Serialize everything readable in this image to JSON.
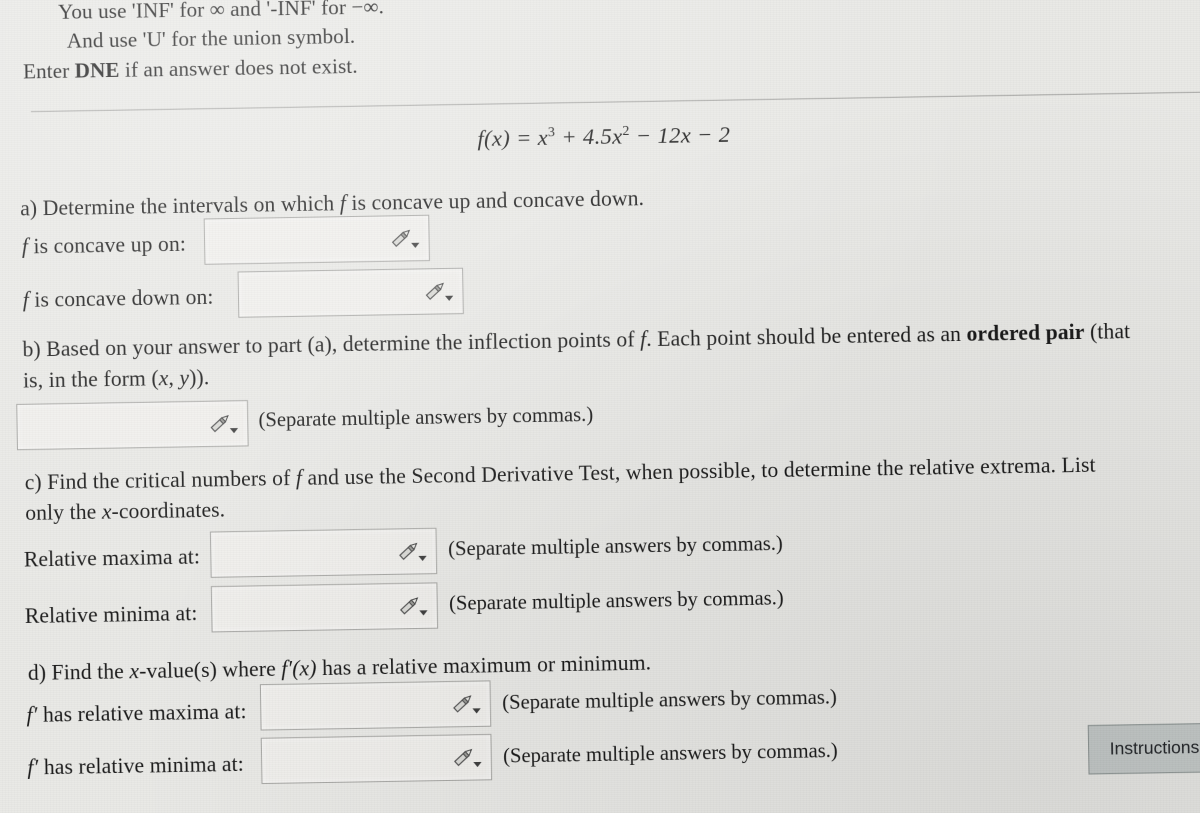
{
  "page": {
    "background_color": "#e9e9e6",
    "text_color": "#1b1b1b"
  },
  "header": {
    "line1": "You use 'INF' for ∞ and '-INF' for −∞.",
    "line2": "And use 'U' for the union symbol.",
    "line3_pre": "Enter ",
    "line3_bold": "DNE",
    "line3_post": " if an answer does not exist."
  },
  "equation": {
    "lhs": "f(x) = ",
    "term1": "x",
    "term1_exp": "3",
    "term2": " + 4.5x",
    "term2_exp": "2",
    "term3": " − 12x − 2",
    "plain": "f(x) = x^3 + 4.5x^2 − 12x − 2"
  },
  "parts": {
    "a": {
      "prompt": "a) Determine the intervals on which f is concave up and concave down.",
      "prompt_segments": [
        "a) Determine the intervals on which ",
        "f",
        " is concave up and concave down."
      ],
      "fields": [
        {
          "label_pre": "f",
          "label_post": " is concave up on:",
          "value": "",
          "icon": "pencil-icon"
        },
        {
          "label_pre": "f",
          "label_post": " is concave down on:",
          "value": "",
          "icon": "pencil-icon"
        }
      ]
    },
    "b": {
      "prompt_1a": "b) Based on your answer to part (a), determine the inflection points of ",
      "prompt_1b": "f",
      "prompt_1c": ". Each point should be entered as an ",
      "prompt_1_bold": "ordered pair",
      "prompt_1d": " (that",
      "prompt_2a": "is, in the form (",
      "prompt_2b": "x",
      "prompt_2c": ", ",
      "prompt_2d": "y",
      "prompt_2e": ")).",
      "field": {
        "value": "",
        "icon": "pencil-icon"
      },
      "hint": "(Separate multiple answers by commas.)"
    },
    "c": {
      "prompt_1a": "c) Find the critical numbers of ",
      "prompt_1b": "f",
      "prompt_1c": " and use the Second Derivative Test, when possible, to determine the relative extrema. List",
      "prompt_2a": "only the ",
      "prompt_2b": "x",
      "prompt_2c": "-coordinates.",
      "fields": [
        {
          "label": "Relative maxima at:",
          "value": "",
          "icon": "pencil-icon",
          "hint": "(Separate multiple answers by commas.)"
        },
        {
          "label": "Relative minima at:",
          "value": "",
          "icon": "pencil-icon",
          "hint": "(Separate multiple answers by commas.)"
        }
      ]
    },
    "d": {
      "prompt_a": "d) Find the ",
      "prompt_b": "x",
      "prompt_c": "-value(s) where ",
      "prompt_d": "f′(x)",
      "prompt_e": " has a relative maximum or minimum.",
      "fields": [
        {
          "label_pre": "f′",
          "label_post": " has relative maxima at:",
          "value": "",
          "icon": "pencil-icon",
          "hint": "(Separate multiple answers by commas.)"
        },
        {
          "label_pre": "f′",
          "label_post": " has relative minima at:",
          "value": "",
          "icon": "pencil-icon",
          "hint": "(Separate multiple answers by commas.)"
        }
      ]
    }
  },
  "instructions_button": {
    "label": "Instructions",
    "background_color": "#c3c8c7"
  }
}
